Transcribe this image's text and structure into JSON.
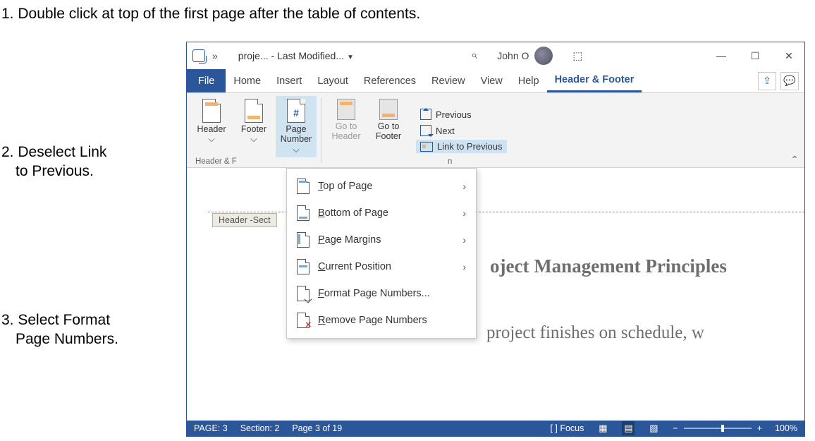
{
  "instructions": {
    "step1": "1. Double click at top of the first page after the table of contents.",
    "step2a": "2. Deselect Link",
    "step2b": "to Previous.",
    "step3a": "3. Select Format",
    "step3b": "Page Numbers."
  },
  "titlebar": {
    "docname": "proje... - Last Modified...",
    "user": "John O"
  },
  "tabs": {
    "file": "File",
    "home": "Home",
    "insert": "Insert",
    "layout": "Layout",
    "references": "References",
    "review": "Review",
    "view": "View",
    "help": "Help",
    "headerfooter": "Header & Footer"
  },
  "ribbon": {
    "header": "Header",
    "footer": "Footer",
    "pagenumber1": "Page",
    "pagenumber2": "Number",
    "gotoheader1": "Go to",
    "gotoheader2": "Header",
    "gotofooter1": "Go to",
    "gotofooter2": "Footer",
    "previous": "Previous",
    "next": "Next",
    "linkprev": "Link to Previous",
    "group_label": "Header & F",
    "nav_suffix": "n"
  },
  "dropdown": {
    "top": "op of Page",
    "bottom": "ottom of Page",
    "margins": "age Margins",
    "current": "urrent Position",
    "format": "ormat Page Numbers...",
    "remove": "emove Page Numbers"
  },
  "document": {
    "header_tag": "Header -Sect",
    "title": "oject Management Principles",
    "body": "project finishes on schedule, w"
  },
  "statusbar": {
    "page": "PAGE: 3",
    "section": "Section: 2",
    "pageof": "Page 3 of 19",
    "focus": "Focus",
    "zoom": "100%"
  }
}
